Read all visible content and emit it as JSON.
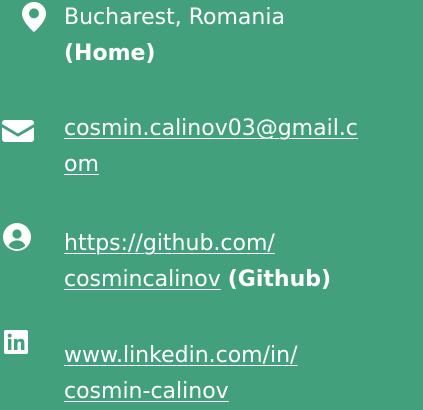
{
  "contacts": {
    "location": {
      "icon": "map-marker-icon",
      "text": "Bucharest, Romania",
      "note": "(Home)"
    },
    "email": {
      "icon": "envelope-icon",
      "link_part1": "cosmin.calinov03@gmail.c",
      "link_part2": "om"
    },
    "github": {
      "icon": "user-circle-icon",
      "link_part1": "https://github.com/",
      "link_part2": "cosmincalinov",
      "note": "(Github)"
    },
    "linkedin": {
      "icon": "linkedin-icon",
      "link_part1": "www.linkedin.com/in/",
      "link_part2": "cosmin-calinov"
    }
  },
  "colors": {
    "background": "#43a07d",
    "text": "#ffffff"
  }
}
